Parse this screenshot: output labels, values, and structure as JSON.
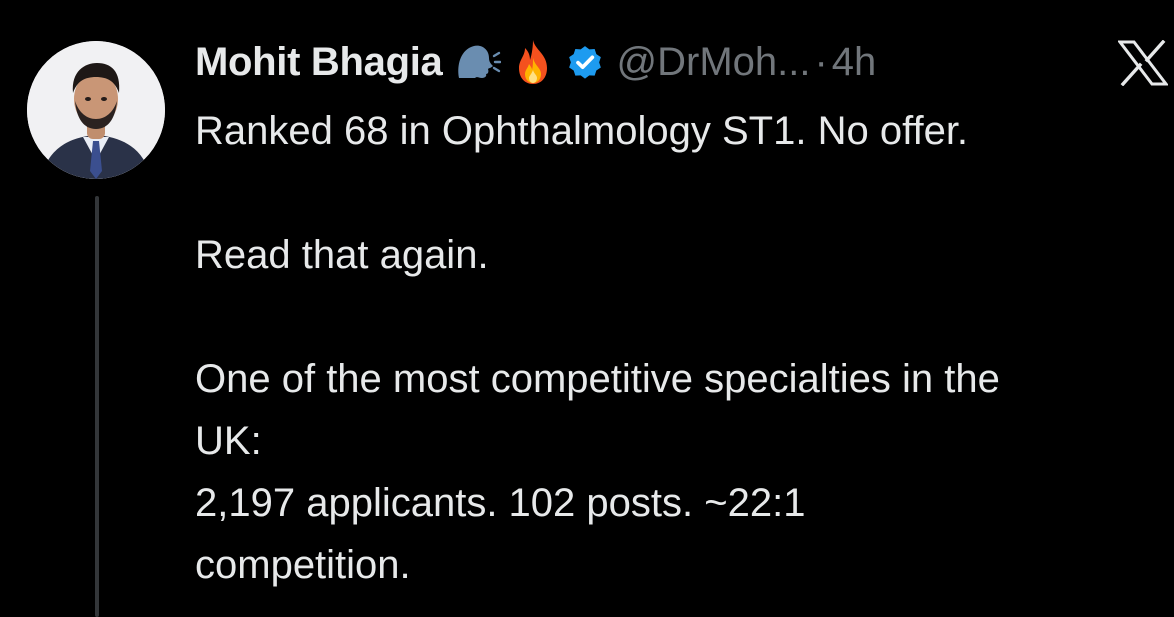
{
  "tweet": {
    "author": {
      "display_name": "Mohit Bhagia",
      "emojis": [
        "speaking-head-emoji",
        "fire-emoji"
      ],
      "verified": true,
      "handle": "@DrMoh...",
      "separator": "·",
      "time": "4h"
    },
    "platform_icon": "x-logo-icon",
    "text_lines": [
      "Ranked 68 in Ophthalmology ST1. No offer.",
      "",
      "Read that again.",
      "",
      "One of the most competitive specialties in the",
      "UK:",
      "2,197 applicants. 102 posts. ~22:1",
      "competition."
    ]
  },
  "colors": {
    "background": "#000000",
    "primary_text": "#e7e9ea",
    "secondary_text": "#71767b",
    "verified_blue": "#1d9bf0",
    "thread_line": "#333639"
  }
}
